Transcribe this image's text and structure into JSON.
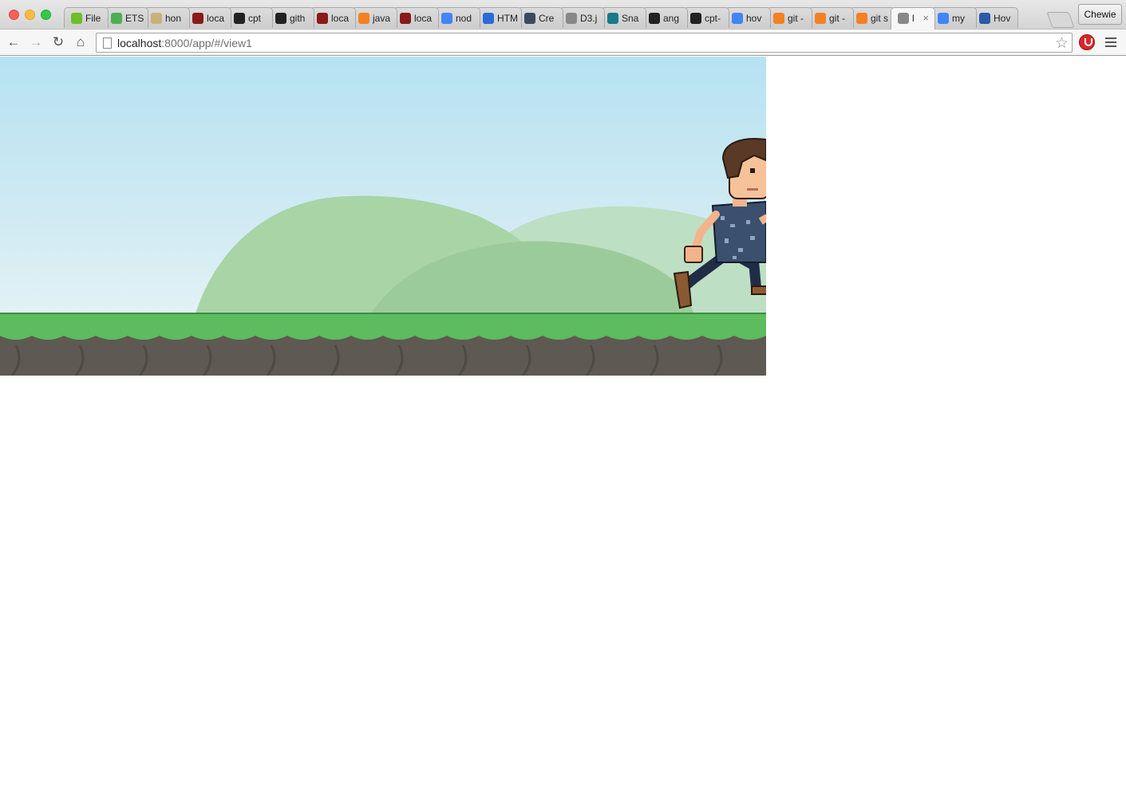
{
  "window": {
    "profile_name": "Chewie"
  },
  "tabs": [
    {
      "label": "File",
      "icon": "hexagon-icon",
      "color": "#6ebd2a"
    },
    {
      "label": "ETS",
      "icon": "q-icon",
      "color": "#4caf50"
    },
    {
      "label": "hon",
      "icon": "envelope-icon",
      "color": "#c8b27a"
    },
    {
      "label": "loca",
      "icon": "hat-icon",
      "color": "#8b1a1a"
    },
    {
      "label": "cpt",
      "icon": "github-icon",
      "color": "#222222"
    },
    {
      "label": "gith",
      "icon": "github-icon",
      "color": "#222222"
    },
    {
      "label": "loca",
      "icon": "hat-icon",
      "color": "#8b1a1a"
    },
    {
      "label": "java",
      "icon": "stackoverflow-icon",
      "color": "#f48024"
    },
    {
      "label": "loca",
      "icon": "hat-icon",
      "color": "#8b1a1a"
    },
    {
      "label": "nod",
      "icon": "google-icon",
      "color": "#4285f4"
    },
    {
      "label": "HTM",
      "icon": "bluetooth-icon",
      "color": "#2a6bd6"
    },
    {
      "label": "Cre",
      "icon": "cube-icon",
      "color": "#3a4a60"
    },
    {
      "label": "D3.j",
      "icon": "page-icon",
      "color": "#888888"
    },
    {
      "label": "Sna",
      "icon": "s-icon",
      "color": "#1a7a8a"
    },
    {
      "label": "ang",
      "icon": "github-icon",
      "color": "#222222"
    },
    {
      "label": "cpt-",
      "icon": "github-icon",
      "color": "#222222"
    },
    {
      "label": "hov",
      "icon": "google-icon",
      "color": "#4285f4"
    },
    {
      "label": "git -",
      "icon": "stackoverflow-icon",
      "color": "#f48024"
    },
    {
      "label": "git -",
      "icon": "stackoverflow-icon",
      "color": "#f48024"
    },
    {
      "label": "git s",
      "icon": "stackoverflow-icon",
      "color": "#f48024"
    },
    {
      "label": "l",
      "icon": "page-icon",
      "color": "#888888",
      "active": true
    },
    {
      "label": "my",
      "icon": "google-icon",
      "color": "#4285f4"
    },
    {
      "label": "Hov",
      "icon": "db-icon",
      "color": "#2a5aa8"
    }
  ],
  "address_bar": {
    "host": "localhost",
    "rest": ":8000/app/#/view1"
  },
  "game": {
    "sky_top": "#b6e2f2",
    "hill_color": "#a6d3a2",
    "grass_color": "#5cbc5e",
    "dirt_color": "#5e5953"
  }
}
